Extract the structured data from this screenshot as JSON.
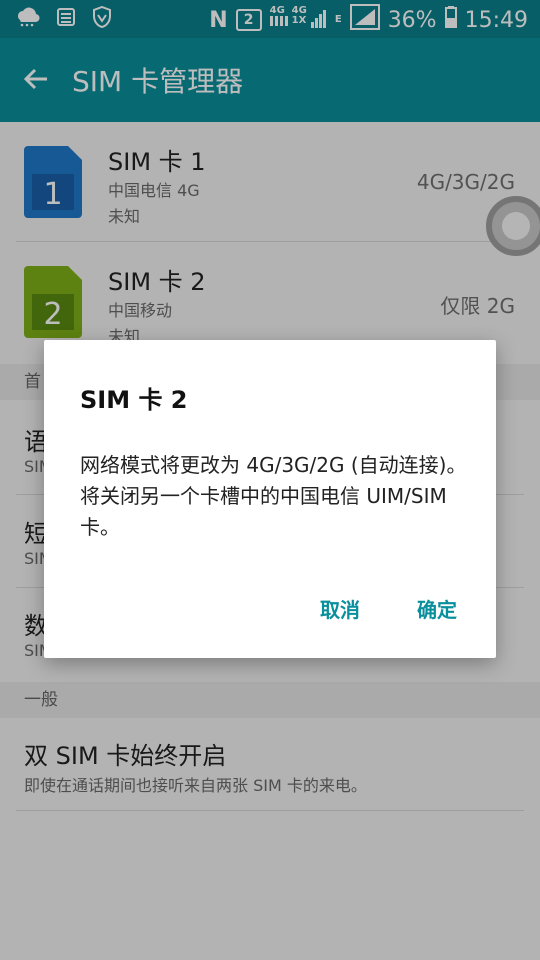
{
  "status_bar": {
    "net_letter": "N",
    "sim_badge": "2",
    "net_top_1": "4G",
    "net_top_2": "4G",
    "net_bottom": "1X",
    "net_e": "E",
    "battery": "36%",
    "time": "15:49"
  },
  "app_bar": {
    "title": "SIM 卡管理器"
  },
  "sims": [
    {
      "number": "1",
      "title": "SIM 卡 1",
      "carrier": "中国电信 4G",
      "status": "未知",
      "mode": "4G/3G/2G",
      "color": "#1e78c8"
    },
    {
      "number": "2",
      "title": "SIM 卡 2",
      "carrier": "中国移动",
      "status": "未知",
      "mode": "仅限 2G",
      "color": "#7fb017"
    }
  ],
  "sections": {
    "preferred_initial": "首",
    "general": "一般"
  },
  "settings": [
    {
      "title_initial": "语",
      "sub_prefix": "SIM"
    },
    {
      "title_initial": "短",
      "sub_prefix": "SIM"
    },
    {
      "title_initial": "数",
      "sub_prefix": "SIM"
    }
  ],
  "dual_sim": {
    "title": "双 SIM 卡始终开启",
    "subtitle": "即使在通话期间也接听来自两张 SIM 卡的来电。"
  },
  "dialog": {
    "title": "SIM 卡 2",
    "message": "网络模式将更改为 4G/3G/2G (自动连接)。 将关闭另一个卡槽中的中国电信 UIM/SIM 卡。",
    "cancel": "取消",
    "ok": "确定"
  },
  "colors": {
    "accent": "#0a8f9c",
    "status_bar": "#0a7f8c"
  }
}
